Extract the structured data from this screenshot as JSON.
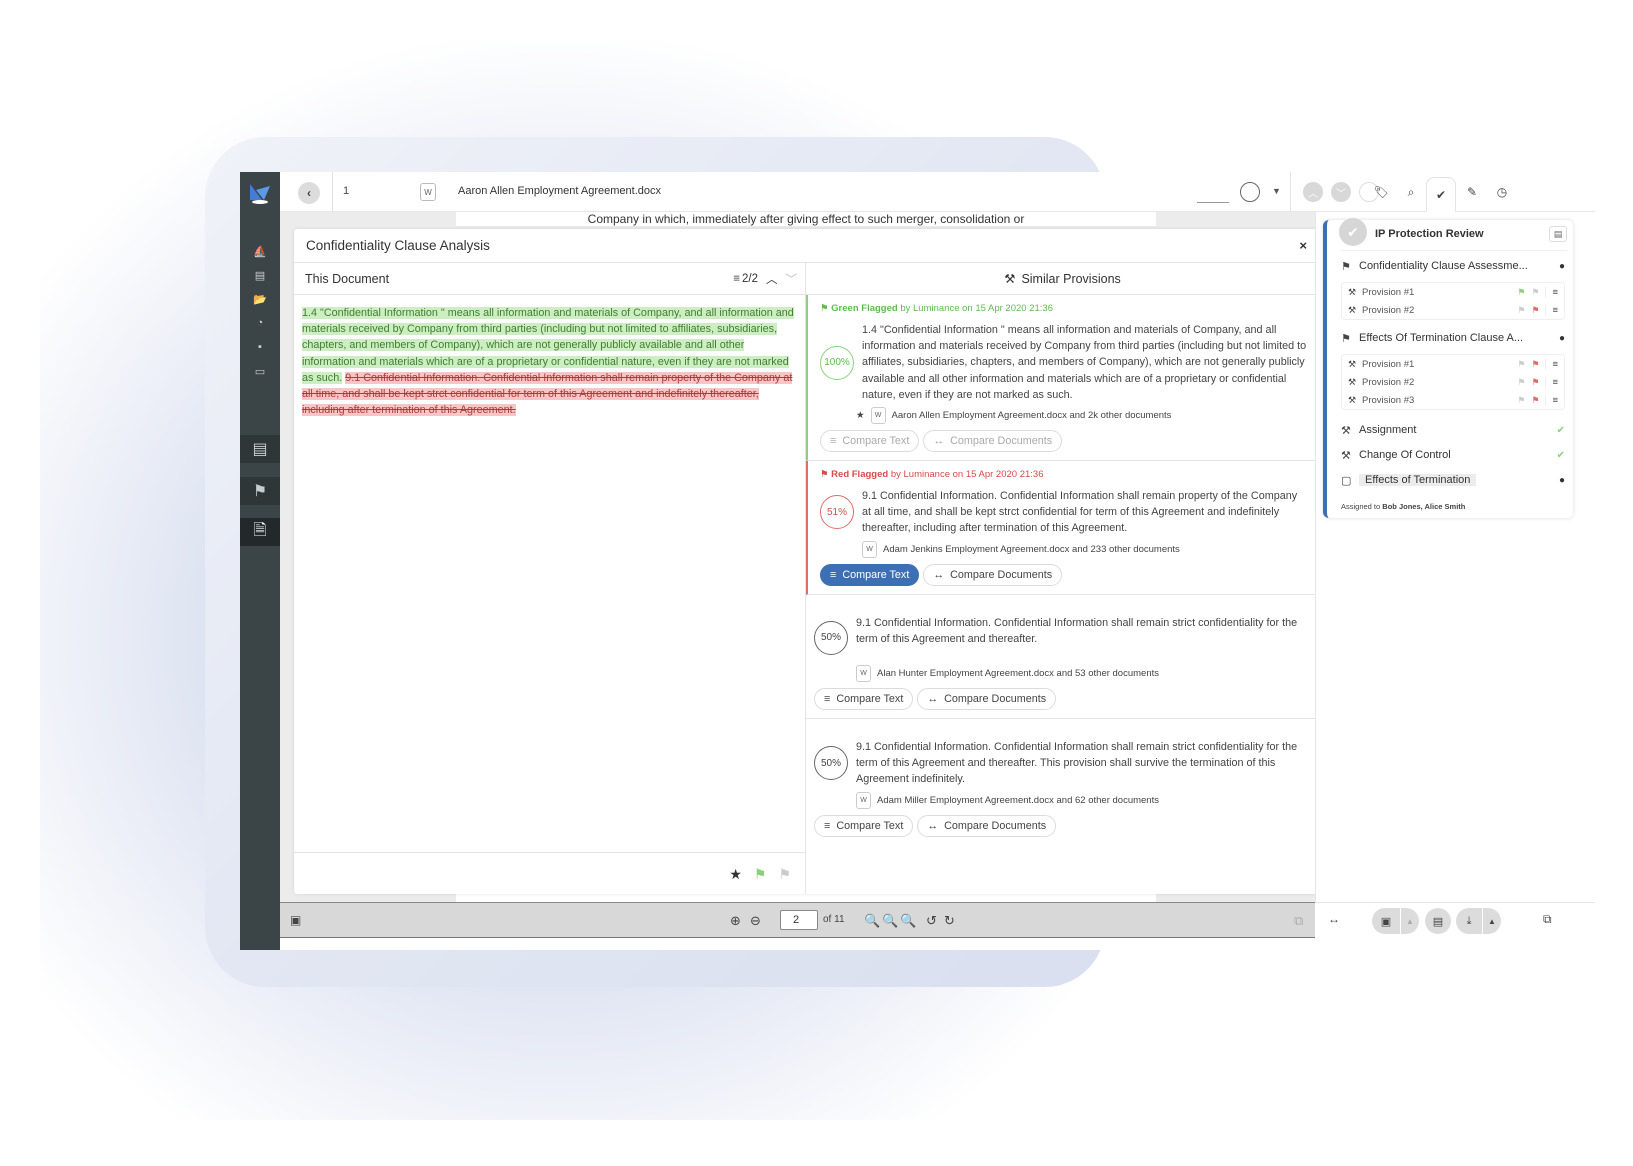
{
  "topbar": {
    "page_number": "1",
    "doc_title": "Aaron Allen Employment Agreement.docx",
    "doc_icon": "word-doc-icon"
  },
  "document_page": {
    "visible_line": "Company in which, immediately after giving effect to such merger, consolidation or"
  },
  "analysis": {
    "title": "Confidentiality Clause Analysis",
    "close_label": "×",
    "this_document": {
      "heading": "This Document",
      "match_counter": "2/2",
      "green_text": "1.4 \"Confidential Information \" means all information and materials of Company, and all information and materials received by Company from third parties (including but not limited to affiliates, subsidiaries, chapters, and members of Company), which are not generally publicly available and all other information and materials which are of a proprietary or confidential nature, even if they are not marked as such.",
      "red_text": "9.1 Confidential Information. Confidential Information shall remain property of the Company at all time, and shall be kept strct confidential for term of this Agreement and indefinitely thereafter, including after termination of this Agreement."
    },
    "similar_provisions": {
      "heading": "Similar Provisions",
      "items": [
        {
          "flag": "green",
          "flag_label": "Green Flagged",
          "flag_meta": " by Luminance on 15 Apr 2020 21:36",
          "percent": "100%",
          "text": "1.4 \"Confidential Information \" means all information and materials of Company, and all information and materials received by Company from third parties (including but not limited to affiliates, subsidiaries, chapters, and members of Company), which are not generally publicly available and all other information and materials which are of a proprietary or confidential nature, even if they are not marked as such.",
          "source": "Aaron Allen Employment Agreement.docx and 2k other documents",
          "starred": true,
          "compare_text": "Compare Text",
          "compare_docs": "Compare Documents"
        },
        {
          "flag": "red",
          "flag_label": "Red Flagged",
          "flag_meta": " by Luminance on 15 Apr 2020 21:36",
          "percent": "51%",
          "text": "9.1 Confidential Information. Confidential Information shall remain property of the Company at all time, and shall be kept strct confidential for term of this Agreement and indefinitely thereafter, including after termination of this Agreement.",
          "source": "Adam Jenkins Employment Agreement.docx and 233 other documents",
          "compare_text": "Compare Text",
          "compare_docs": "Compare Documents"
        },
        {
          "flag": "none",
          "percent": "50%",
          "text": "9.1 Confidential Information. Confidential Information shall remain strict confidentiality for the term of this Agreement and thereafter.",
          "source": "Alan Hunter Employment Agreement.docx and 53 other documents",
          "compare_text": "Compare Text",
          "compare_docs": "Compare Documents"
        },
        {
          "flag": "none",
          "percent": "50%",
          "text": "9.1 Confidential Information. Confidential Information shall remain strict confidentiality for the term of this Agreement and thereafter. This provision shall survive the termination of this Agreement indefinitely.",
          "source": "Adam Miller Employment Agreement.docx and 62 other documents",
          "compare_text": "Compare Text",
          "compare_docs": "Compare Documents"
        }
      ]
    }
  },
  "bottombar": {
    "page_input": "2",
    "of_label": "of 11"
  },
  "review": {
    "title": "IP Protection Review",
    "groups": [
      {
        "label": "Confidentiality Clause Assessme...",
        "provisions": [
          {
            "label": "Provision #1",
            "green_active": true
          },
          {
            "label": "Provision #2",
            "red_active": true
          }
        ]
      },
      {
        "label": "Effects Of Termination Clause A...",
        "provisions": [
          {
            "label": "Provision #1"
          },
          {
            "label": "Provision #2"
          },
          {
            "label": "Provision #3"
          }
        ]
      }
    ],
    "items": [
      {
        "label": "Assignment",
        "status": "✔"
      },
      {
        "label": "Change Of Control",
        "status": "✔"
      },
      {
        "label": "Effects of Termination",
        "status": "●"
      }
    ],
    "assigned_prefix": "Assigned to ",
    "assigned_names": "Bob Jones, Alice Smith"
  },
  "colors": {
    "accent_blue": "#3c6fb4",
    "green_flag": "#5cbd4a",
    "red_flag": "#d94a4a",
    "sidebar_bg": "#3b4447"
  }
}
